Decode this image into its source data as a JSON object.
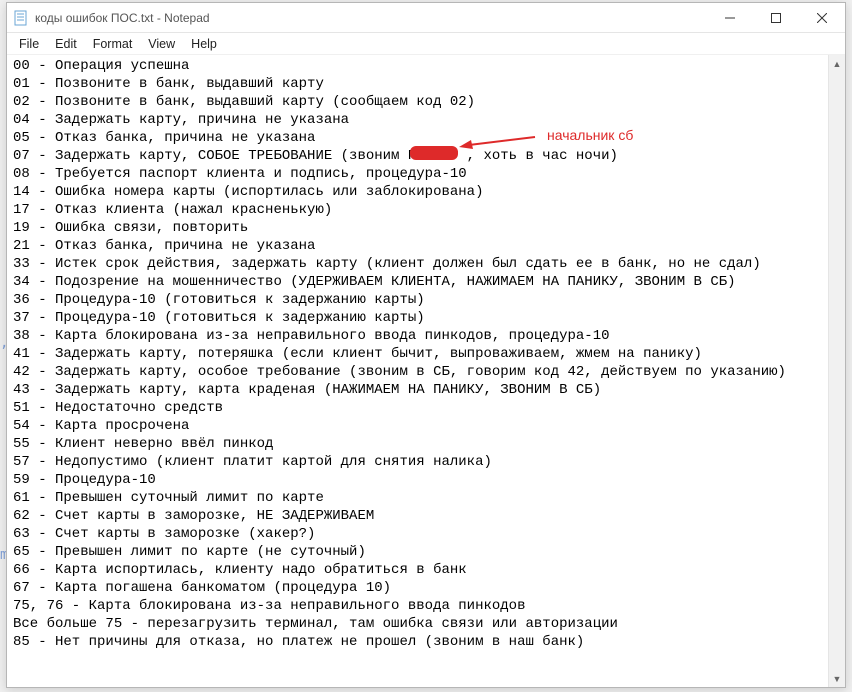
{
  "titlebar": {
    "title": "коды ошибок ПОС.txt - Notepad"
  },
  "menu": {
    "file": "File",
    "edit": "Edit",
    "format": "Format",
    "view": "View",
    "help": "Help"
  },
  "annotation": {
    "label": "начальник сб"
  },
  "lines": [
    "00 - Операция успешна",
    "01 - Позвоните в банк, выдавший карту",
    "02 - Позвоните в банк, выдавший карту (сообщаем код 02)",
    "04 - Задержать карту, причина не указана",
    "05 - Отказ банка, причина не указана",
    "07 - Задержать карту, СОБОЕ ТРЕБОВАНИЕ (звоним П      , хоть в час ночи)",
    "08 - Требуется паспорт клиента и подпись, процедура-10",
    "14 - Ошибка номера карты (испортилась или заблокирована)",
    "17 - Отказ клиента (нажал красненькую)",
    "19 - Ошибка связи, повторить",
    "21 - Отказ банка, причина не указана",
    "33 - Истек срок действия, задержать карту (клиент должен был сдать ее в банк, но не сдал)",
    "34 - Подозрение на мошенничество (УДЕРЖИВАЕМ КЛИЕНТА, НАЖИМАЕМ НА ПАНИКУ, ЗВОНИМ В СБ)",
    "36 - Процедура-10 (готовиться к задержанию карты)",
    "37 - Процедура-10 (готовиться к задержанию карты)",
    "38 - Карта блокирована из-за неправильного ввода пинкодов, процедура-10",
    "41 - Задержать карту, потеряшка (если клиент бычит, выпроваживаем, жмем на панику)",
    "42 - Задержать карту, особое требование (звоним в СБ, говорим код 42, действуем по указанию)",
    "43 - Задержать карту, карта краденая (НАЖИМАЕМ НА ПАНИКУ, ЗВОНИМ В СБ)",
    "51 - Недостаточно средств",
    "54 - Карта просрочена",
    "55 - Клиент неверно ввёл пинкод",
    "57 - Недопустимо (клиент платит картой для снятия налика)",
    "59 - Процедура-10",
    "61 - Превышен суточный лимит по карте",
    "62 - Счет карты в заморозке, НЕ ЗАДЕРЖИВАЕМ",
    "63 - Счет карты в заморозке (хакер?)",
    "65 - Превышен лимит по карте (не суточный)",
    "66 - Карта испортилась, клиенту надо обратиться в банк",
    "67 - Карта погашена банкоматом (процедура 10)",
    "75, 76 - Карта блокирована из-за неправильного ввода пинкодов",
    "Все больше 75 - перезагрузить терминал, там ошибка связи или авторизации",
    "85 - Нет причины для отказа, но платеж не прошел (звоним в наш банк)"
  ],
  "behind": {
    "comma": ",",
    "m": "m"
  }
}
